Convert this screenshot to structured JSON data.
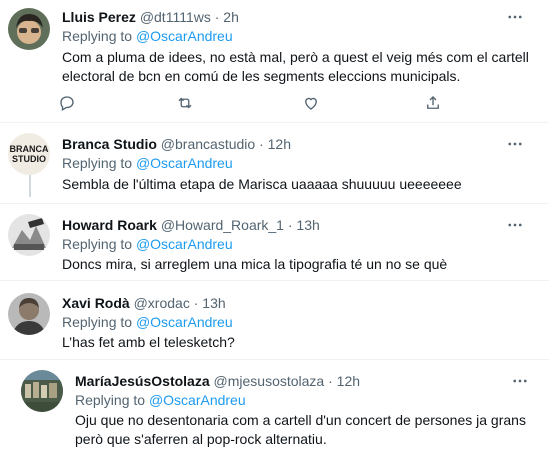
{
  "tweets": [
    {
      "name": "Lluis Perez",
      "handle": "@dt1111ws",
      "dot": "·",
      "time": "2h",
      "replying_prefix": "Replying to ",
      "replying_to": "@OscarAndreu",
      "text": "Com a pluma de idees, no està mal, però a quest el veig més com el cartell electoral de bcn en comú de les segments eleccions municipals."
    },
    {
      "name": "Branca Studio",
      "handle": "@brancastudio",
      "dot": "·",
      "time": "12h",
      "avatar_text": "BRANCA STUDIO",
      "replying_prefix": "Replying to ",
      "replying_to": "@OscarAndreu",
      "text": "Sembla de l'última etapa de Marisca uaaaaa shuuuuu ueeeeeee"
    },
    {
      "name": "Howard Roark",
      "handle": "@Howard_Roark_1",
      "dot": "·",
      "time": "13h",
      "replying_prefix": "Replying to ",
      "replying_to": "@OscarAndreu",
      "text": "Doncs mira, si arreglem una mica la tipografia té un no se què"
    },
    {
      "name": "Xavi Rodà",
      "handle": "@xrodac",
      "dot": "·",
      "time": "13h",
      "replying_prefix": "Replying to ",
      "replying_to": "@OscarAndreu",
      "text": "L’has fet amb el telesketch?"
    },
    {
      "name": "MaríaJesúsOstolaza",
      "handle": "@mjesusostolaza",
      "dot": "·",
      "time": "12h",
      "replying_prefix": "Replying to ",
      "replying_to": "@OscarAndreu",
      "text": "Oju que no desentonaria com a cartell d'un concert de persones ja grans però que s'aferren al pop-rock alternatiu."
    }
  ],
  "icons": [
    "more-icon",
    "reply-icon",
    "retweet-icon",
    "like-icon",
    "share-icon"
  ],
  "colors": {
    "accent": "#1d9bf0",
    "secondary_text": "#536471",
    "divider": "#eff3f4"
  }
}
